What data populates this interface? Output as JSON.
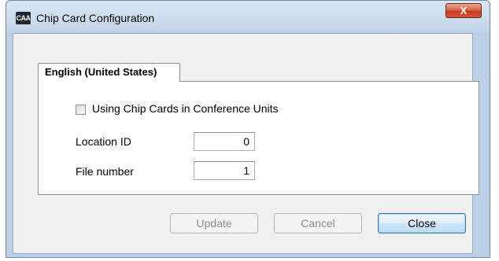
{
  "window": {
    "icon_text": "CAA",
    "title": "Chip Card Configuration",
    "close_glyph": "X"
  },
  "tab": {
    "label": "English (United States)"
  },
  "form": {
    "checkbox_label": "Using Chip Cards in Conference Units",
    "checkbox_checked": false,
    "location_label": "Location ID",
    "location_value": "0",
    "file_label": "File number",
    "file_value": "1"
  },
  "buttons": {
    "update": "Update",
    "cancel": "Cancel",
    "close": "Close"
  },
  "colors": {
    "close_button": "#c9452a",
    "focused_button_border": "#3c7fb1",
    "disabled_text": "#8d8d8d"
  }
}
